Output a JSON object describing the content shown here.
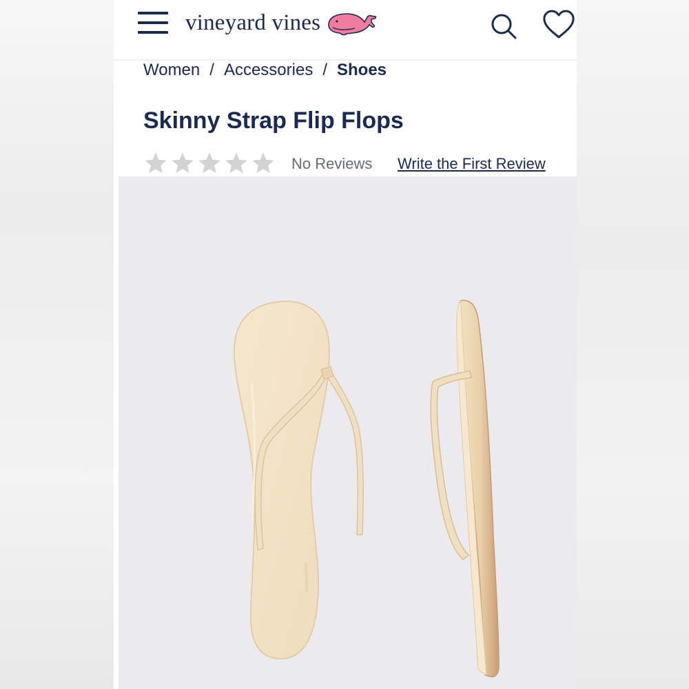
{
  "header": {
    "logo_text": "vineyard vines",
    "logo_color": "#1b2a50",
    "whale_color": "#f07ca0",
    "icons": [
      "menu-icon",
      "whale-logo-icon",
      "search-icon",
      "heart-icon"
    ]
  },
  "breadcrumb": {
    "items": [
      "Women",
      "Accessories",
      "Shoes"
    ],
    "separator": "/"
  },
  "product": {
    "title": "Skinny Strap Flip Flops",
    "rating": 0,
    "rating_max": 5,
    "reviews_label": "No Reviews",
    "write_review_label": "Write the First Review",
    "image_alt": "Cream skinny strap flip flops, top and side view",
    "image_bg": "#ebebee",
    "sandal_color": "#f3e2c6",
    "sole_edge_color": "#d2a880"
  }
}
